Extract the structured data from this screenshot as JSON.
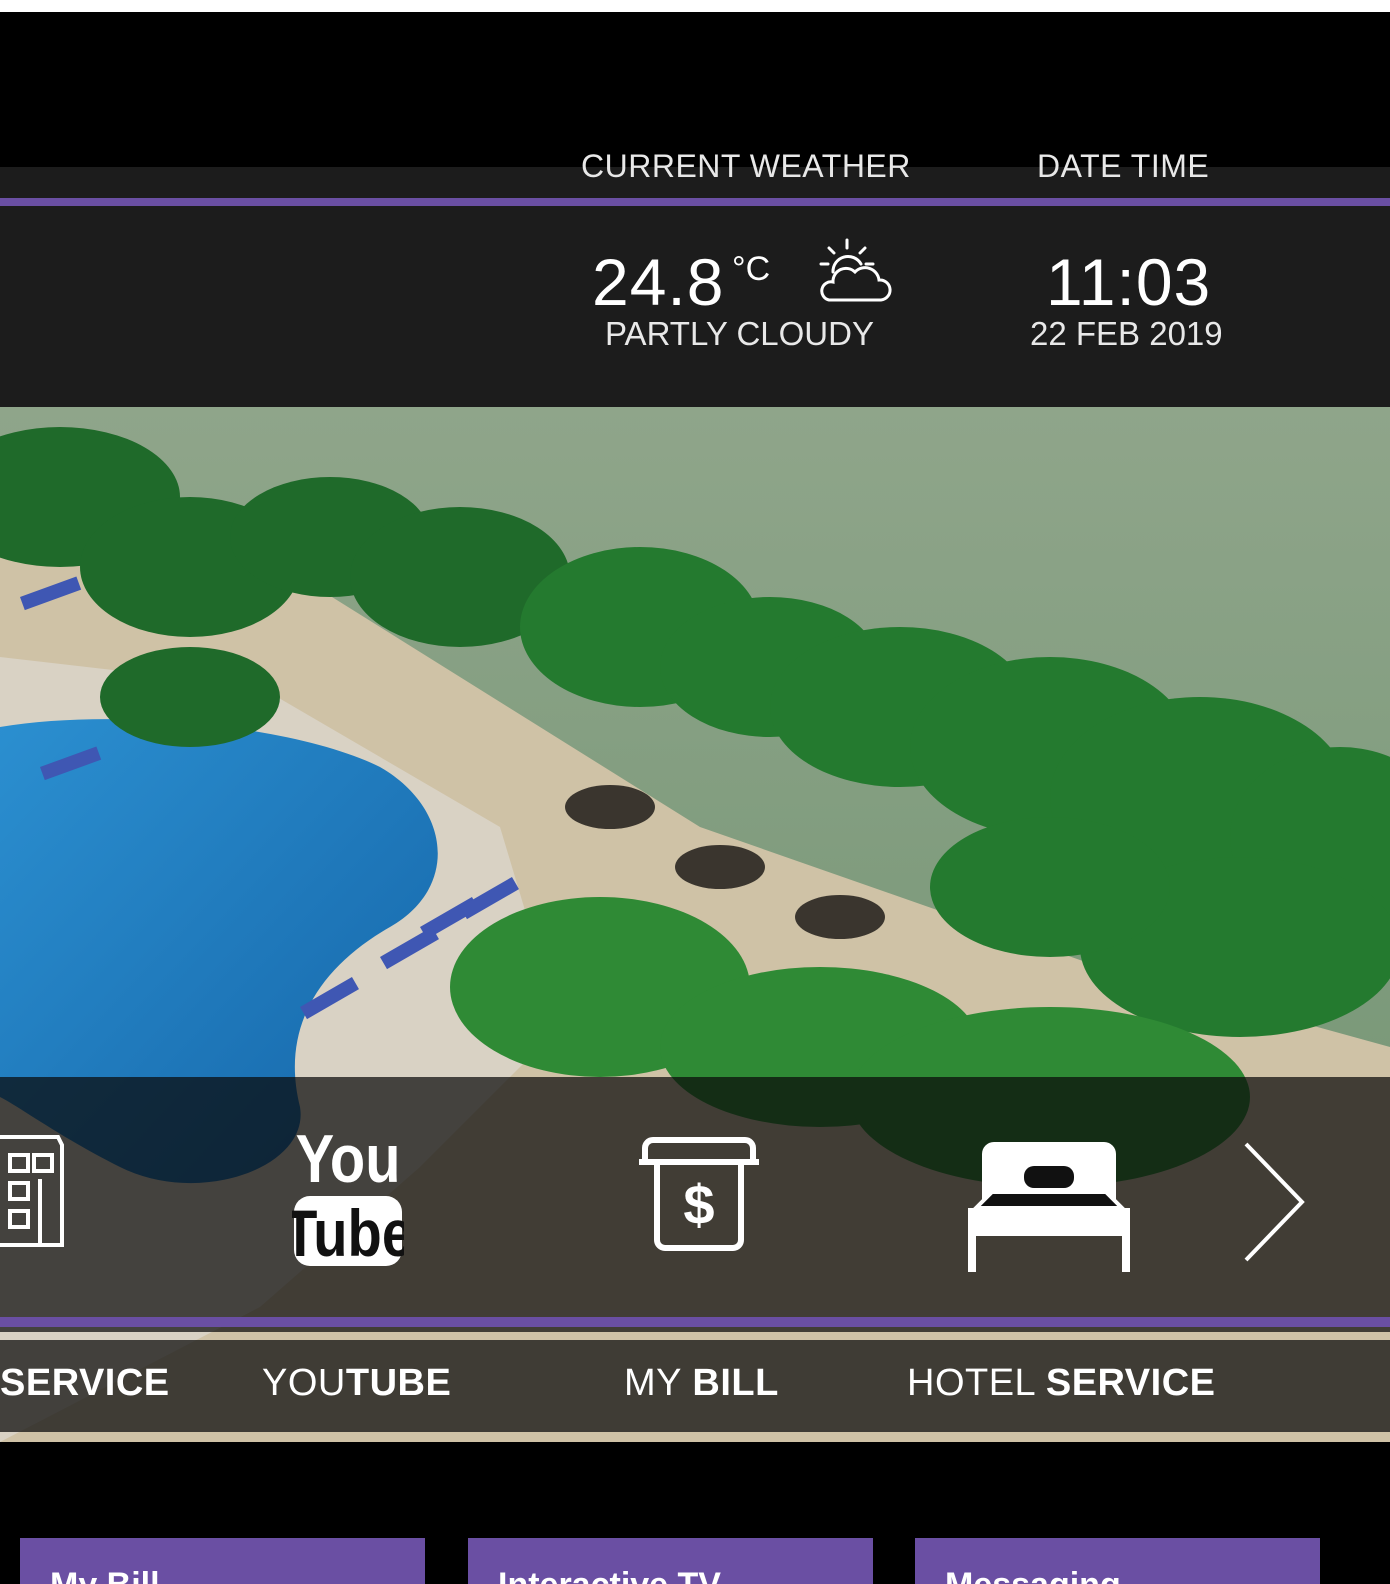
{
  "weather": {
    "heading": "CURRENT WEATHER",
    "temperature": "24.8",
    "unit": "°C",
    "condition": "PARTLY CLOUDY",
    "icon": "partly-cloudy-icon"
  },
  "datetime": {
    "heading": "DATE TIME",
    "time": "11:03",
    "date": "22 FEB 2019"
  },
  "dock": {
    "items": [
      {
        "pre": "",
        "bold": "SERVICE",
        "icon": "building-icon"
      },
      {
        "pre": "YOU",
        "bold": "TUBE",
        "icon": "youtube-icon"
      },
      {
        "pre": "MY ",
        "bold": "BILL",
        "icon": "bill-icon"
      },
      {
        "pre": "HOTEL ",
        "bold": "SERVICE",
        "icon": "bed-icon"
      }
    ],
    "youtube_logo": {
      "top": "You",
      "bottom": "Tube"
    },
    "bill_symbol": "$",
    "next_icon": "chevron-right-icon"
  },
  "cards": [
    {
      "label": "My Bill"
    },
    {
      "label": "Interactive TV"
    },
    {
      "label": "Messaging"
    }
  ],
  "colors": {
    "accent": "#6a4fa3",
    "background": "#000000"
  }
}
